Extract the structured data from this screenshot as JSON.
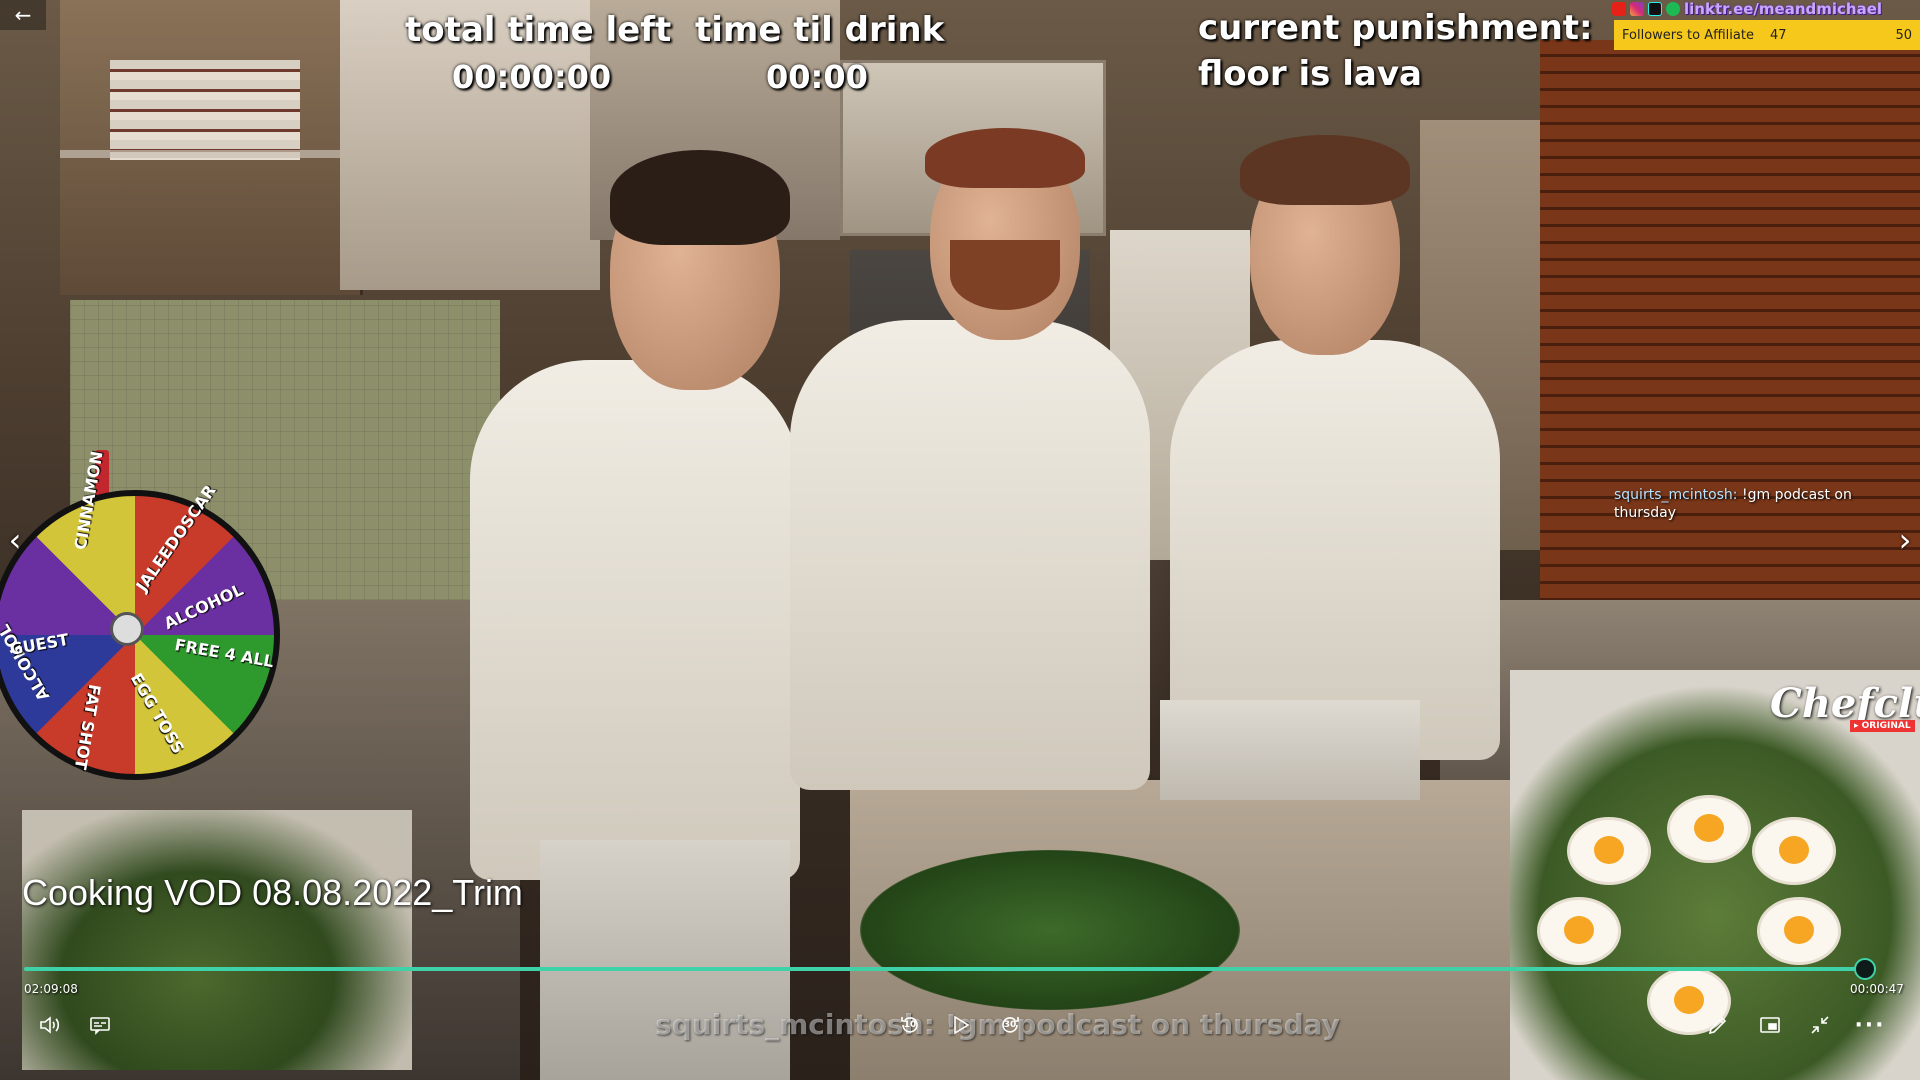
{
  "stream_overlay": {
    "total_time_label": "total time left",
    "total_time_value": "00:00:00",
    "drink_label": "time til drink",
    "drink_value": "00:00",
    "punishment_label": "current punishment:",
    "punishment_value": "floor is lava"
  },
  "social": {
    "linktree": "linktr.ee/meandmichael",
    "icons": [
      "youtube-icon",
      "instagram-icon",
      "tiktok-icon",
      "spotify-icon"
    ]
  },
  "followers_goal": {
    "label": "Followers to Affiliate",
    "current": "47",
    "goal": "50",
    "progress_fraction": 0.94
  },
  "chat": {
    "username": "squirts_mcintosh:",
    "message": "!gm podcast on thursday"
  },
  "wheel": {
    "labels": [
      "CINNAMON",
      "JALEEDOSCAR",
      "ALCOHOL",
      "FREE 4 ALL",
      "EGG TOSS",
      "FAT SHOT",
      "ALCOHOL",
      "GUEST"
    ]
  },
  "pip_right": {
    "brand": "Chefclub",
    "brand_sub": "▸ ORIGINAL"
  },
  "stream_caption": "squirts_mcintosh: !gm podcast on thursday",
  "player": {
    "title": "Cooking VOD 08.08.2022_Trim",
    "elapsed": "02:09:08",
    "remaining": "00:00:47",
    "progress_fraction": 0.994,
    "accent": "#3fd2a8",
    "replay_seconds": "10",
    "forward_seconds": "30",
    "more_label": "···"
  }
}
